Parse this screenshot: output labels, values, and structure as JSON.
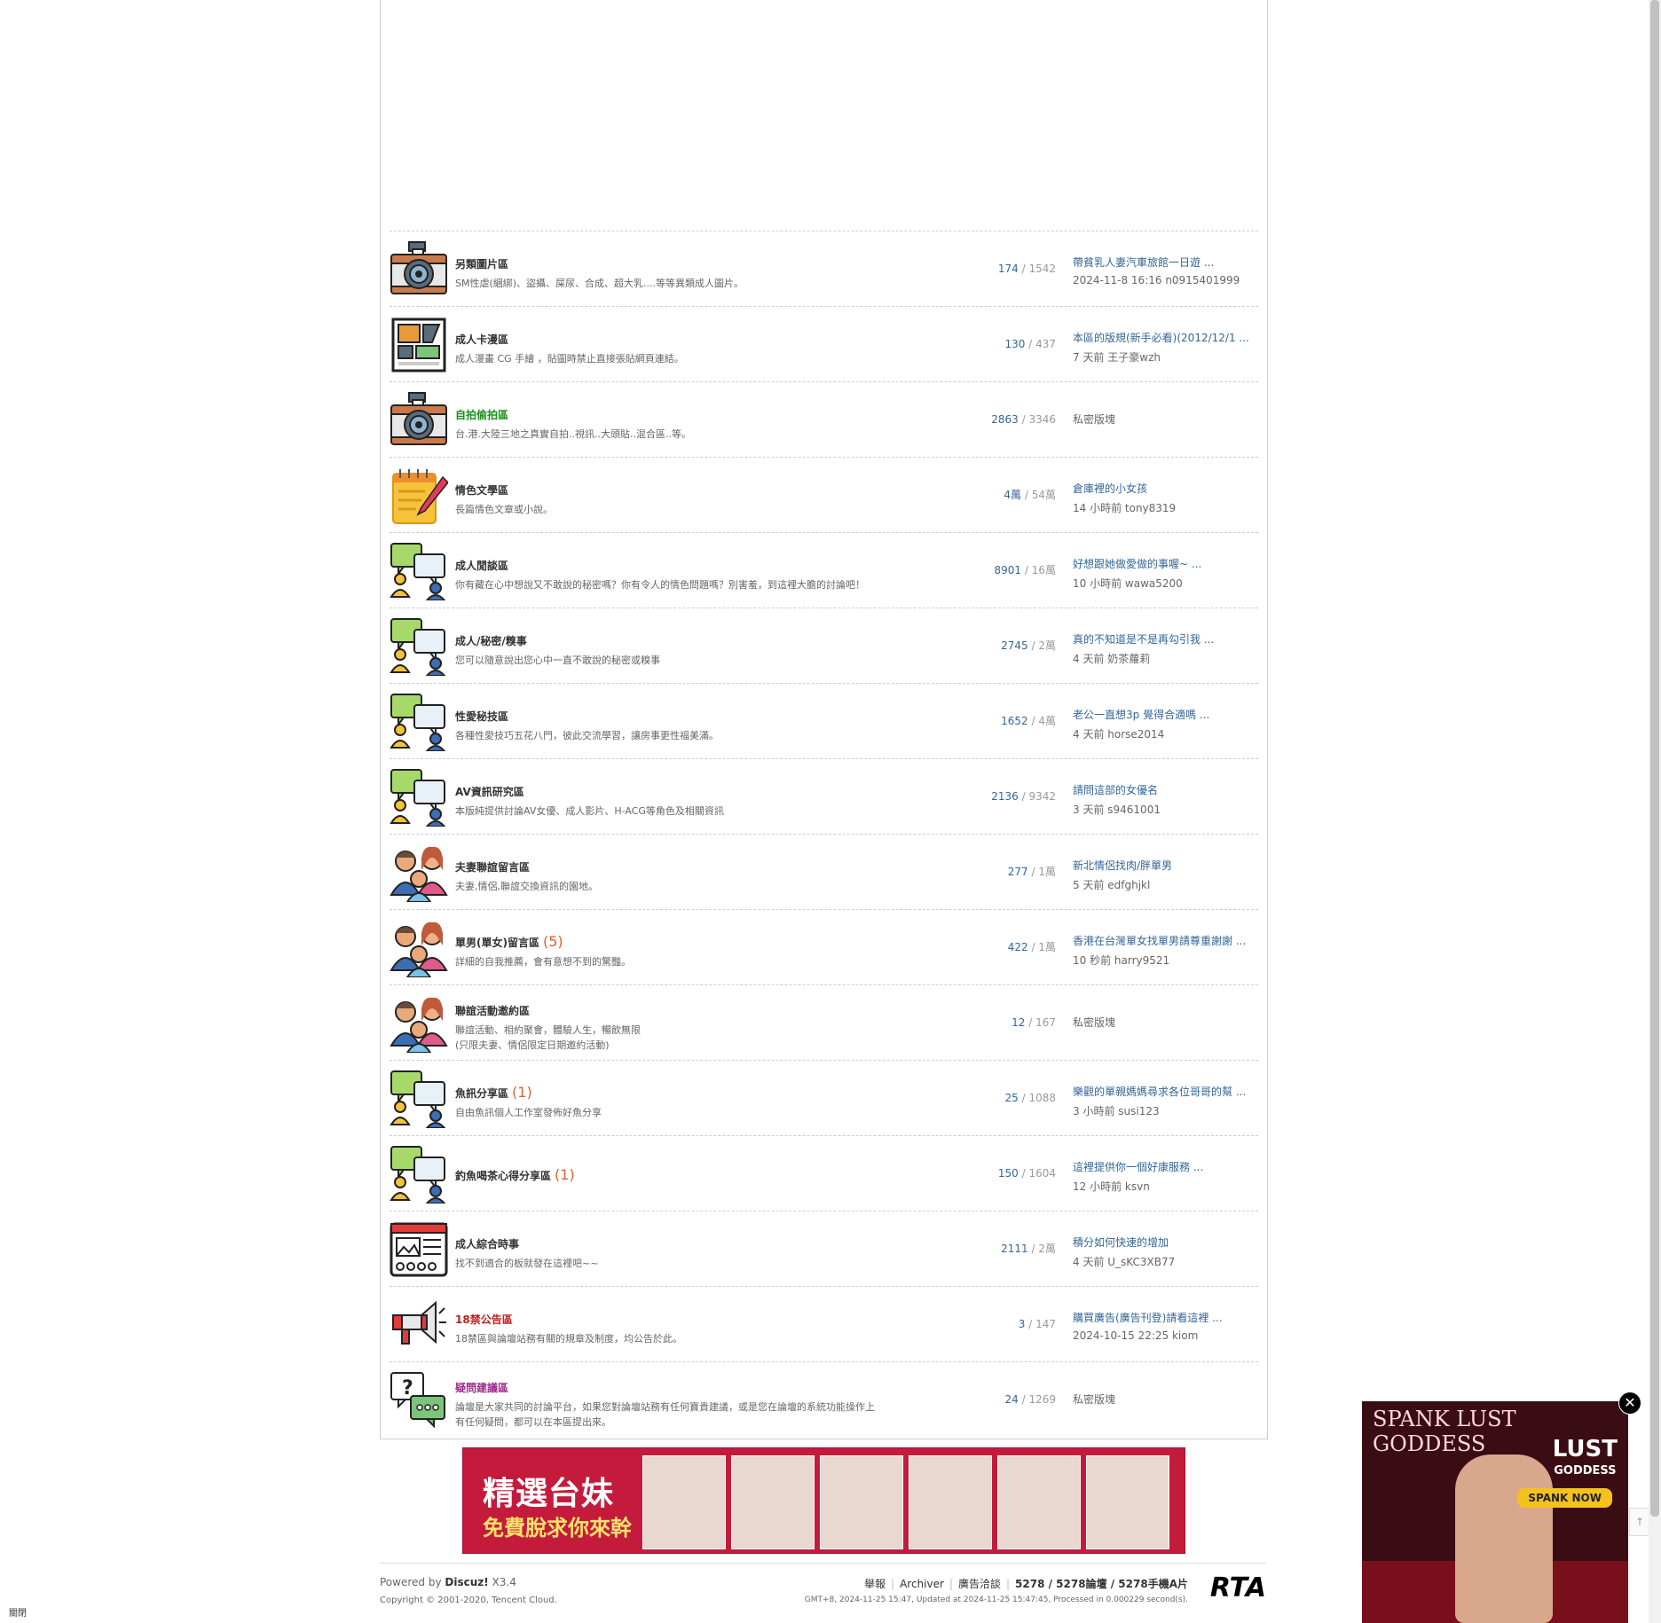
{
  "forums": [
    {
      "name": "另類圖片區",
      "new": "",
      "desc": [
        "SM性虐(綑綁)、盜攝、屎尿、合成、超大乳....等等異類成人圖片。"
      ],
      "threads": "174",
      "posts": "1542",
      "last_title": "帶貧乳人妻汽車旅館一日遊 ...",
      "last_meta": "2024-11-8 16:16 n0915401999",
      "icon": "camera-icon",
      "color": "normal"
    },
    {
      "name": "成人卡漫區",
      "new": "",
      "desc": [
        "成人漫畫 CG 手繪 ，貼圖時禁止直接張貼網頁連結。"
      ],
      "threads": "130",
      "posts": "437",
      "last_title": "本區的版規(新手必看)(2012/12/1 ...",
      "last_meta": "7 天前 王子豪wzh",
      "icon": "comic-icon",
      "color": "normal"
    },
    {
      "name": "自拍偷拍區",
      "new": "",
      "desc": [
        "台.港.大陸三地之真實自拍..視訊..大頭貼..混合區..等。"
      ],
      "threads": "2863",
      "posts": "3346",
      "last_title": "",
      "last_meta": "私密版塊",
      "icon": "camera-icon",
      "color": "green"
    },
    {
      "name": "情色文學區",
      "new": "",
      "desc": [
        "長篇情色文章或小說。"
      ],
      "threads": "4萬",
      "posts": "54萬",
      "last_title": "倉庫裡的小女孩",
      "last_meta": "14 小時前 tony8319",
      "icon": "notepad-icon",
      "color": "normal"
    },
    {
      "name": "成人閒談區",
      "new": "",
      "desc": [
        "你有藏在心中想說又不敢說的秘密嗎？你有令人的情色問題嗎？別害羞，到這裡大膽的討論吧！"
      ],
      "threads": "8901",
      "posts": "16萬",
      "last_title": "好想跟她做愛做的事喔~ ...",
      "last_meta": "10 小時前 wawa5200",
      "icon": "chat-icon",
      "color": "normal"
    },
    {
      "name": "成人/秘密/糗事",
      "new": "",
      "desc": [
        "您可以隨意說出您心中一直不敢說的秘密或糗事"
      ],
      "threads": "2745",
      "posts": "2萬",
      "last_title": "真的不知道是不是再勾引我 ...",
      "last_meta": "4 天前 奶茶蘿莉",
      "icon": "chat-icon",
      "color": "normal"
    },
    {
      "name": "性愛秘技區",
      "new": "",
      "desc": [
        "各種性愛技巧五花八門，彼此交流學習，讓房事更性福美滿。"
      ],
      "threads": "1652",
      "posts": "4萬",
      "last_title": "老公一直想3p 覺得合適嗎 ...",
      "last_meta": "4 天前 horse2014",
      "icon": "chat-icon",
      "color": "normal"
    },
    {
      "name": "AV資訊研究區",
      "new": "",
      "desc": [
        "本版純提供討論AV女優、成人影片、H-ACG等角色及相關資訊"
      ],
      "threads": "2136",
      "posts": "9342",
      "last_title": "請問這部的女優名",
      "last_meta": "3 天前 s9461001",
      "icon": "chat-icon",
      "color": "normal"
    },
    {
      "name": "夫妻聯誼留言區",
      "new": "",
      "desc": [
        "夫妻,情侶,聯誼交換資訊的園地。"
      ],
      "threads": "277",
      "posts": "1萬",
      "last_title": "新北情侶找肉/胖單男",
      "last_meta": "5 天前 edfghjkl",
      "icon": "people-icon",
      "color": "normal"
    },
    {
      "name": "單男(單女)留言區",
      "new": "(5)",
      "desc": [
        "詳細的自我推薦，會有意想不到的驚豔。"
      ],
      "threads": "422",
      "posts": "1萬",
      "last_title": "香港在台灣單女找單男請尊重謝謝 ...",
      "last_meta": "10 秒前 harry9521",
      "icon": "people-icon",
      "color": "normal"
    },
    {
      "name": "聯誼活動邀約區",
      "new": "",
      "desc": [
        "聯誼活動、相約聚會，體驗人生，暢飲無限",
        "(只限夫妻、情侶限定日期邀約活動)"
      ],
      "threads": "12",
      "posts": "167",
      "last_title": "",
      "last_meta": "私密版塊",
      "icon": "people-icon",
      "color": "normal"
    },
    {
      "name": "魚訊分享區",
      "new": "(1)",
      "desc": [
        "自由魚訊個人工作室發佈好魚分享"
      ],
      "threads": "25",
      "posts": "1088",
      "last_title": "樂觀的單親媽媽尋求各位哥哥的幫 ...",
      "last_meta": "3 小時前 susi123",
      "icon": "chat-icon",
      "color": "normal"
    },
    {
      "name": "釣魚喝茶心得分享區",
      "new": "(1)",
      "desc": [],
      "threads": "150",
      "posts": "1604",
      "last_title": "這裡提供你一個好康服務 ...",
      "last_meta": "12 小時前 ksvn",
      "icon": "chat-icon",
      "color": "normal"
    },
    {
      "name": "成人綜合時事",
      "new": "",
      "desc": [
        "找不到適合的板就發在這裡吧~~"
      ],
      "threads": "2111",
      "posts": "2萬",
      "last_title": "積分如何快速的增加",
      "last_meta": "4 天前 U_sKC3XB77",
      "icon": "webpage-icon",
      "color": "normal"
    },
    {
      "name": "18禁公告區",
      "new": "",
      "desc": [
        "18禁區與論壇站務有關的規章及制度，均公告於此。"
      ],
      "threads": "3",
      "posts": "147",
      "last_title": "購買廣告(廣告刊登)請看這裡 ...",
      "last_meta": "2024-10-15 22:25 kiom",
      "icon": "megaphone-icon",
      "color": "red"
    },
    {
      "name": "疑問建議區",
      "new": "",
      "desc": [
        "論壇是大家共同的討論平台，如果您對論壇站務有任何寶貴建議，或是您在論壇的系統功能操作上",
        "有任何疑問，都可以在本區提出來。"
      ],
      "threads": "24",
      "posts": "1269",
      "last_title": "",
      "last_meta": "私密版塊",
      "icon": "question-chat-icon",
      "color": "purple"
    }
  ],
  "banner": {
    "title": "精選台妹",
    "subtitle": "免費脫求你來幹"
  },
  "footer": {
    "powered_prefix": "Powered by ",
    "powered_brand": "Discuz!",
    "powered_version": " X3.4",
    "copyright": "Copyright © 2001-2020, Tencent Cloud.",
    "link_report": "舉報",
    "link_archiver": "Archiver",
    "link_ads": "廣告洽談",
    "stats": "5278 / 5278論壇 / 5278手機A片",
    "gmt": "GMT+8, 2024-11-25 15:47, Updated at 2024-11-25 15:47:45, Processed in 0.000229 second(s).",
    "rta": "RTA"
  },
  "ad": {
    "title": "SPANK LUST GODDESS",
    "logo_line1": "LUST",
    "logo_line2": "GODDESS",
    "button": "SPANK NOW",
    "close": "✕"
  },
  "bottom_left": "關閉",
  "side_tab": "↑",
  "colors": {
    "link": "#336699",
    "green": "#1b8f1b",
    "red": "#c21d1d",
    "purple": "#9c2a8a",
    "new_count": "#e06030"
  }
}
